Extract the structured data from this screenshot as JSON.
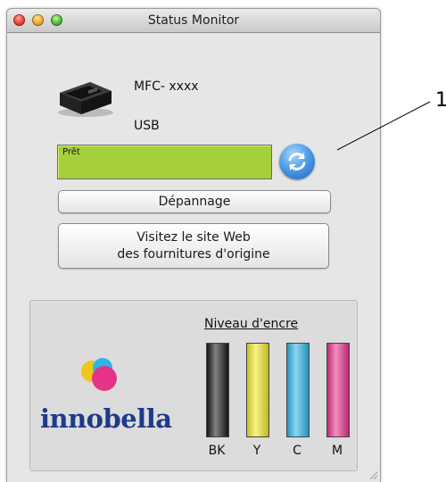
{
  "window": {
    "title": "Status Monitor"
  },
  "device": {
    "model": "MFC- xxxx",
    "connection": "USB"
  },
  "status": {
    "text": "Prêt",
    "color": "#a5cf3b"
  },
  "buttons": {
    "troubleshoot": "Dépannage",
    "supplies_line1": "Visitez le site Web",
    "supplies_line2": "des fournitures d'origine"
  },
  "ink": {
    "heading": "Niveau d'encre",
    "brand_logo": "innobella",
    "cartridges": [
      {
        "label": "BK",
        "color": "#1a1a1a",
        "level": 1.0
      },
      {
        "label": "Y",
        "color": "#f2e72a",
        "level": 1.0
      },
      {
        "label": "C",
        "color": "#2fb4e6",
        "level": 1.0
      },
      {
        "label": "M",
        "color": "#e6338a",
        "level": 1.0
      }
    ]
  },
  "callout": {
    "label": "1"
  },
  "icons": {
    "printer": "printer-icon",
    "refresh": "refresh-icon",
    "resize": "resize-grip-icon"
  }
}
